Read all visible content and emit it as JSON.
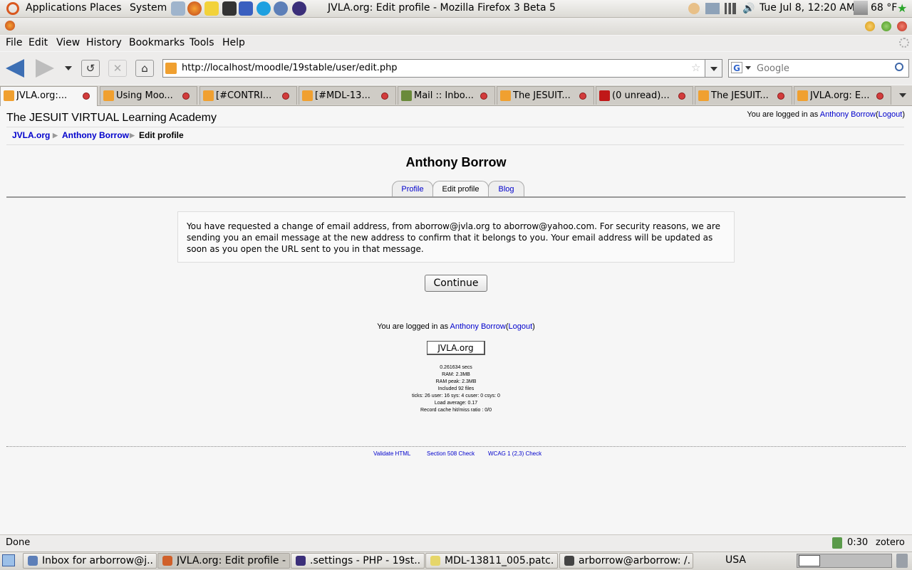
{
  "top_panel": {
    "menus": [
      "Applications",
      "Places",
      "System"
    ],
    "clock": "Tue Jul  8, 12:20 AM",
    "weather": "68 °F"
  },
  "window": {
    "title": "JVLA.org: Edit profile - Mozilla Firefox 3 Beta 5"
  },
  "menubar": [
    "File",
    "Edit",
    "View",
    "History",
    "Bookmarks",
    "Tools",
    "Help"
  ],
  "navbar": {
    "url": "http://localhost/moodle/19stable/user/edit.php",
    "search_placeholder": "Google"
  },
  "tabs": [
    {
      "label": "JVLA.org:...",
      "active": true
    },
    {
      "label": "Using Moo..."
    },
    {
      "label": "[#CONTRI..."
    },
    {
      "label": "[#MDL-13..."
    },
    {
      "label": "Mail :: Inbo..."
    },
    {
      "label": "The JESUIT..."
    },
    {
      "label": "(0 unread)..."
    },
    {
      "label": "The JESUIT..."
    },
    {
      "label": "JVLA.org: E..."
    }
  ],
  "page": {
    "site_title": "The JESUIT VIRTUAL Learning Academy",
    "login_prefix": "You are logged in as",
    "user_name": "Anthony Borrow",
    "logout": "Logout",
    "breadcrumb": [
      "JVLA.org",
      "Anthony Borrow",
      "Edit profile"
    ],
    "heading": "Anthony Borrow",
    "profile_tabs": [
      "Profile",
      "Edit profile",
      "Blog"
    ],
    "notice": "You have requested a change of email address, from aborrow@jvla.org to aborrow@yahoo.com. For security reasons, we are sending you an email message at the new address to confirm that it belongs to you. Your email address will be updated as soon as you open the URL sent to you in that message.",
    "continue_label": "Continue",
    "home_button": "JVLA.org",
    "perf": [
      "0.261634 secs",
      "RAM: 2.3MB",
      "RAM peak: 2.3MB",
      "Included 92 files",
      "ticks: 26 user: 16 sys: 4 cuser: 0 csys: 0",
      "Load average: 0.17",
      "Record cache hit/miss ratio : 0/0"
    ],
    "validators": [
      "Validate HTML",
      "Section 508 Check",
      "WCAG 1 (2,3) Check"
    ]
  },
  "statusbar": {
    "status": "Done",
    "timer": "0:30",
    "zotero": "zotero"
  },
  "taskbar": [
    {
      "label": "Inbox for arborrow@j..."
    },
    {
      "label": "JVLA.org: Edit profile -...",
      "active": true
    },
    {
      "label": ".settings - PHP - 19st..."
    },
    {
      "label": "MDL-13811_005.patc..."
    },
    {
      "label": "arborrow@arborrow: /..."
    }
  ],
  "keyboard_layout": "USA"
}
